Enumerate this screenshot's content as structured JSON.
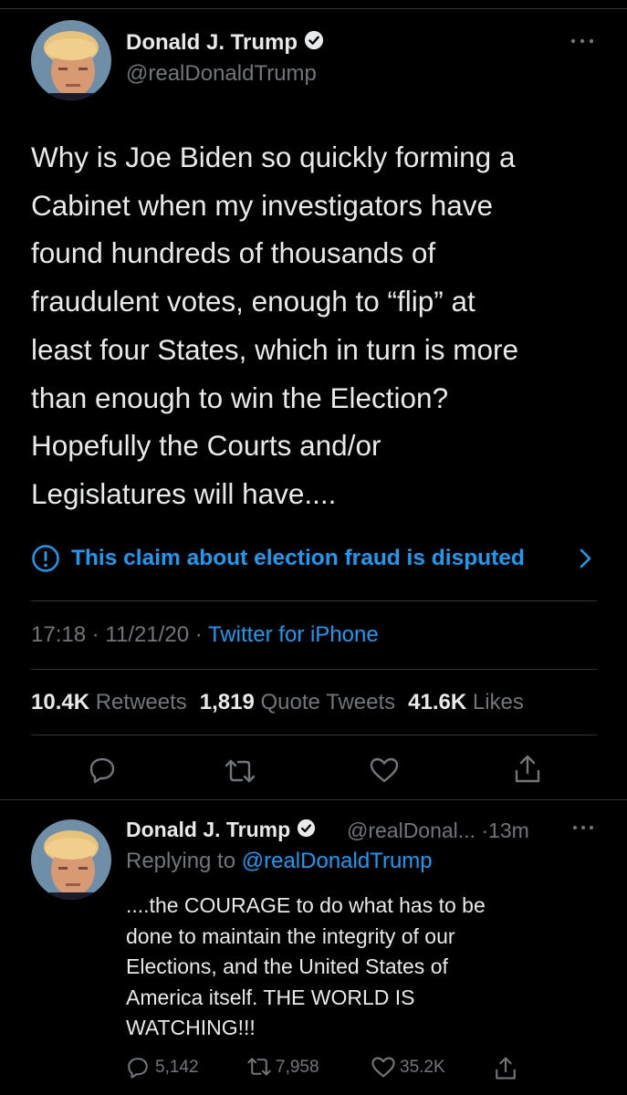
{
  "tweet": {
    "author_name": "Donald J. Trump",
    "author_handle": "@realDonaldTrump",
    "text": "Why is Joe Biden so quickly forming a\nCabinet when my investigators have\nfound hundreds of thousands of\nfraudulent votes, enough to “flip” at\nleast four States, which in turn is more\nthan enough to win the Election?\nHopefully the Courts and/or\nLegislatures will have....",
    "notice": "This claim about election fraud is disputed",
    "time": "17:18",
    "date": "11/21/20",
    "separator": "·",
    "source": "Twitter for iPhone",
    "stats": {
      "retweets_count": "10.4K",
      "retweets_label": "Retweets",
      "quotes_count": "1,819",
      "quotes_label": "Quote Tweets",
      "likes_count": "41.6K",
      "likes_label": "Likes"
    }
  },
  "reply": {
    "author_name": "Donald J. Trump",
    "author_handle": "@realDonal...",
    "age": "13m",
    "separator": "·",
    "replying_label": "Replying to",
    "replying_handle": "@realDonaldTrump",
    "text": "....the COURAGE to do what has to be\ndone to maintain the integrity of our\nElections,  and the United States of\nAmerica itself. THE WORLD IS\nWATCHING!!!",
    "reply_count": "5,142",
    "retweet_count": "7,958",
    "like_count": "35.2K"
  },
  "icons": {
    "verified": "verified-badge-icon",
    "more": "more-horizontal-icon",
    "info": "info-circle-icon",
    "chevron": "chevron-right-icon",
    "reply": "reply-icon",
    "retweet": "retweet-icon",
    "like": "heart-icon",
    "share": "share-icon"
  },
  "colors": {
    "background": "#000000",
    "text": "#e7e9ea",
    "secondary": "#71767b",
    "accent": "#1d9bf0",
    "divider": "#2f3336"
  }
}
